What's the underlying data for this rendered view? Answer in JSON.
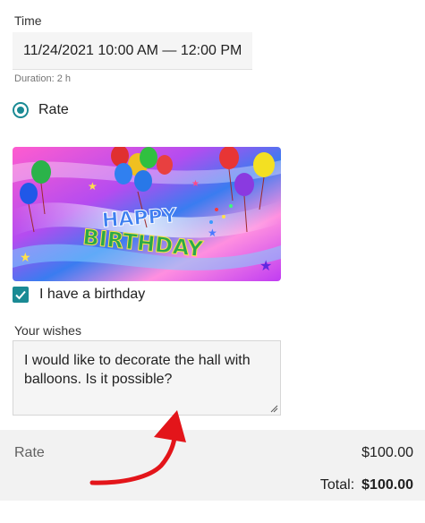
{
  "time": {
    "label": "Time",
    "value": "11/24/2021 10:00 AM — 12:00 PM",
    "duration": "Duration: 2 h"
  },
  "rate_option": {
    "label": "Rate",
    "selected": true
  },
  "birthday_image": {
    "text": "HAPPY BIRTHDAY"
  },
  "birthday_checkbox": {
    "label": "I have a birthday",
    "checked": true
  },
  "wishes": {
    "label": "Your wishes",
    "value": "I would like to decorate the hall with balloons. Is it possible?"
  },
  "summary": {
    "rate_label": "Rate",
    "rate_value": "$100.00",
    "total_label": "Total:",
    "total_value": "$100.00"
  },
  "colors": {
    "accent": "#1a8a94",
    "arrow": "#e3151a"
  }
}
